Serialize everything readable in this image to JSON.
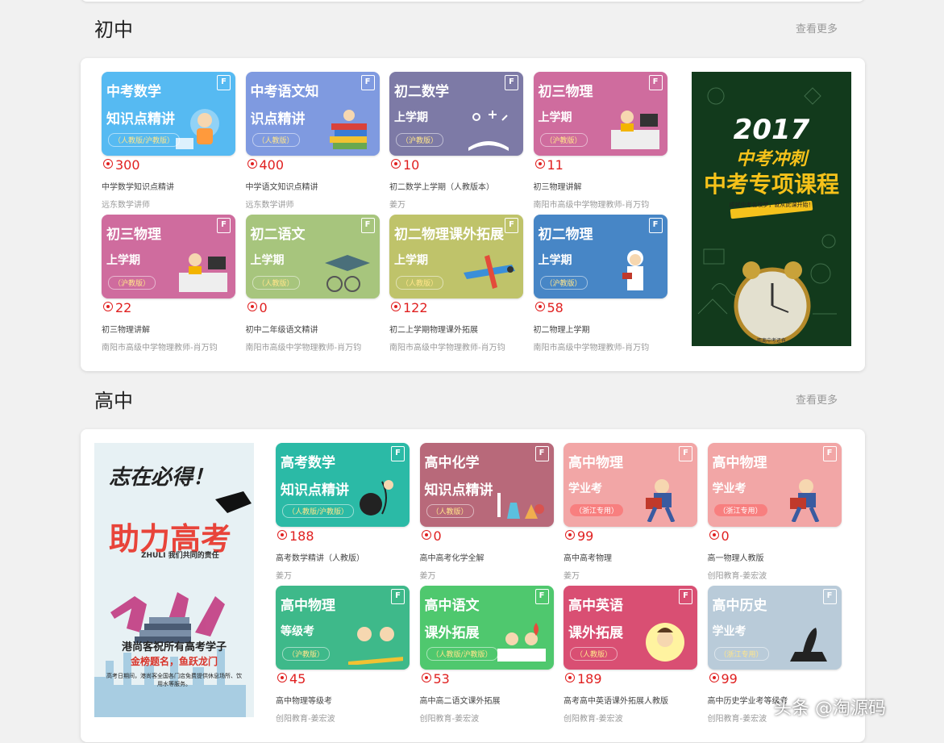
{
  "watermark": "头条 @淘源码",
  "sections": [
    {
      "title": "初中",
      "more": "查看更多",
      "banner": {
        "year": "2017",
        "line1": "中考冲刺",
        "line2": "中考专项课程",
        "ribbon": "成就中考名校梦，就从此课开始！",
        "clock_caption": "距离中考还有"
      },
      "cards": [
        {
          "line1": "中考数学",
          "line2": "知识点精讲",
          "tag": "（人教版/沪教版）",
          "count": "300",
          "title": "中学数学知识点精讲",
          "author": "远东数学讲师",
          "bg": "#56baf2",
          "tagc": ""
        },
        {
          "line1": "中考语文知",
          "line2": "识点精讲",
          "tag": "（人教版）",
          "count": "400",
          "title": "中学语文知识点精讲",
          "author": "远东数学讲师",
          "bg": "#7f9ae0",
          "tagc": ""
        },
        {
          "line1": "初二数学",
          "line2": "上学期",
          "tag": "（沪教版）",
          "count": "10",
          "title": "初二数学上学期（人教版本）",
          "author": "姜万",
          "bg": "#7d7aa6",
          "tagc": ""
        },
        {
          "line1": "初三物理",
          "line2": "上学期",
          "tag": "（沪教版）",
          "count": "11",
          "title": "初三物理讲解",
          "author": "南阳市高级中学物理教师-肖万钧",
          "bg": "#cf6c9e",
          "tagc": ""
        },
        {
          "line1": "初三物理",
          "line2": "上学期",
          "tag": "（沪教版）",
          "count": "22",
          "title": "初三物理讲解",
          "author": "南阳市高级中学物理教师-肖万钧",
          "bg": "#cf6c9e",
          "tagc": ""
        },
        {
          "line1": "初二语文",
          "line2": "上学期",
          "tag": "（人教版）",
          "count": "0",
          "title": "初中二年级语文精讲",
          "author": "南阳市高级中学物理教师-肖万钧",
          "bg": "#a7c57d",
          "tagc": ""
        },
        {
          "line1": "初二物理课外拓展",
          "line2": "上学期",
          "tag": "（人教版）",
          "count": "122",
          "title": "初二上学期物理课外拓展",
          "author": "南阳市高级中学物理教师-肖万钧",
          "bg": "#bfc36a",
          "tagc": ""
        },
        {
          "line1": "初二物理",
          "line2": "上学期",
          "tag": "（沪教版）",
          "count": "58",
          "title": "初二物理上学期",
          "author": "南阳市高级中学物理教师-肖万钧",
          "bg": "#4786c6",
          "tagc": ""
        }
      ]
    },
    {
      "title": "高中",
      "more": "查看更多",
      "banner": {
        "line1": "志在必得！",
        "line2": "助力高考",
        "sub": "ZHULI 我们共同的责任",
        "slogan": "港尚客祝所有高考学子",
        "slogan2": "金榜题名，鱼跃龙门",
        "notice": "高考日期间，港尚客全国各门店免费提供休息场所、饮用水等服务。"
      },
      "cards": [
        {
          "line1": "高考数学",
          "line2": "知识点精讲",
          "tag": "（人教版/沪教版）",
          "count": "188",
          "title": "高考数学精讲（人教版）",
          "author": "姜万",
          "bg": "#2bbaa6",
          "tagc": ""
        },
        {
          "line1": "高中化学",
          "line2": "知识点精讲",
          "tag": "（人教版）",
          "count": "0",
          "title": "高中高考化学全解",
          "author": "姜万",
          "bg": "#b8697a",
          "tagc": ""
        },
        {
          "line1": "高中物理",
          "line2": "学业考",
          "tag": "（浙江专用）",
          "count": "99",
          "title": "高中高考物理",
          "author": "姜万",
          "bg": "#f2a6a6",
          "tagc": "red"
        },
        {
          "line1": "高中物理",
          "line2": "学业考",
          "tag": "（浙江专用）",
          "count": "0",
          "title": "高一物理人教版",
          "author": "创阳教育-姜宏波",
          "bg": "#f2a6a6",
          "tagc": "red"
        },
        {
          "line1": "高中物理",
          "line2": "等级考",
          "tag": "（沪教版）",
          "count": "45",
          "title": "高中物理等级考",
          "author": "创阳教育-姜宏波",
          "bg": "#3eb98a",
          "tagc": ""
        },
        {
          "line1": "高中语文",
          "line2": "课外拓展",
          "tag": "（人教版/沪教版）",
          "count": "53",
          "title": "高中高二语文课外拓展",
          "author": "创阳教育-姜宏波",
          "bg": "#4fc86e",
          "tagc": ""
        },
        {
          "line1": "高中英语",
          "line2": "课外拓展",
          "tag": "（人教版）",
          "count": "189",
          "title": "高考高中英语课外拓展人教版",
          "author": "创阳教育-姜宏波",
          "bg": "#d94f73",
          "tagc": ""
        },
        {
          "line1": "高中历史",
          "line2": "学业考",
          "tag": "（浙江专用）",
          "count": "99",
          "title": "高中历史学业考等级考",
          "author": "创阳教育-姜宏波",
          "bg": "#b9cbd9",
          "tagc": ""
        }
      ]
    }
  ]
}
